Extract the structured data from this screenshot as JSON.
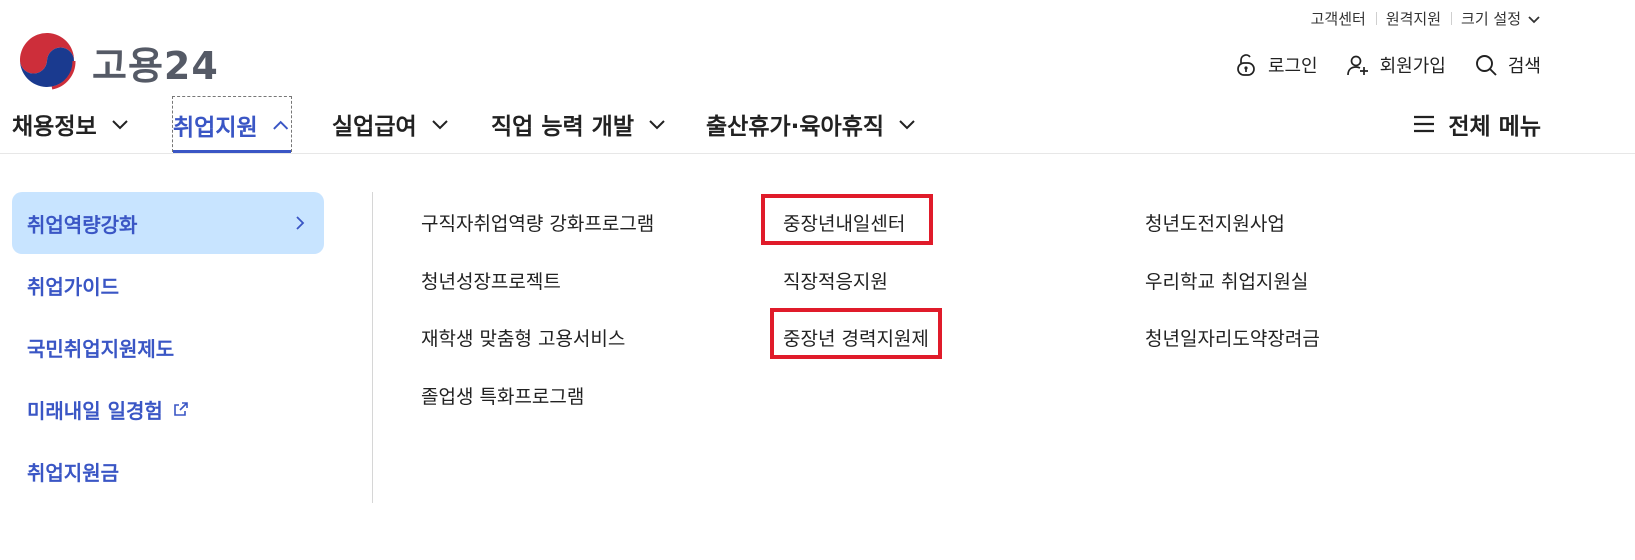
{
  "utility": {
    "customer_center": "고객센터",
    "remote_support": "원격지원",
    "size_setting": "크기 설정"
  },
  "logo": {
    "text": "고용24"
  },
  "account": {
    "login": "로그인",
    "signup": "회원가입",
    "search": "검색"
  },
  "gnb": {
    "items": [
      {
        "label": "채용정보"
      },
      {
        "label": "취업지원"
      },
      {
        "label": "실업급여"
      },
      {
        "label": "직업 능력 개발"
      },
      {
        "label": "출산휴가·육아휴직"
      }
    ],
    "full_menu": "전체 메뉴"
  },
  "lnb": {
    "items": [
      {
        "label": "취업역량강화"
      },
      {
        "label": "취업가이드"
      },
      {
        "label": "국민취업지원제도"
      },
      {
        "label": "미래내일 일경험"
      },
      {
        "label": "취업지원금"
      }
    ]
  },
  "links": {
    "col1": [
      "구직자취업역량 강화프로그램",
      "청년성장프로젝트",
      "재학생 맞춤형 고용서비스",
      "졸업생 특화프로그램"
    ],
    "col2": [
      "중장년내일센터",
      "직장적응지원",
      "중장년 경력지원제"
    ],
    "col3": [
      "청년도전지원사업",
      "우리학교 취업지원실",
      "청년일자리도약장려금"
    ]
  },
  "colors": {
    "accent": "#3a56c5",
    "active_bg": "#c8e4ff",
    "highlight": "#e01b2a"
  }
}
